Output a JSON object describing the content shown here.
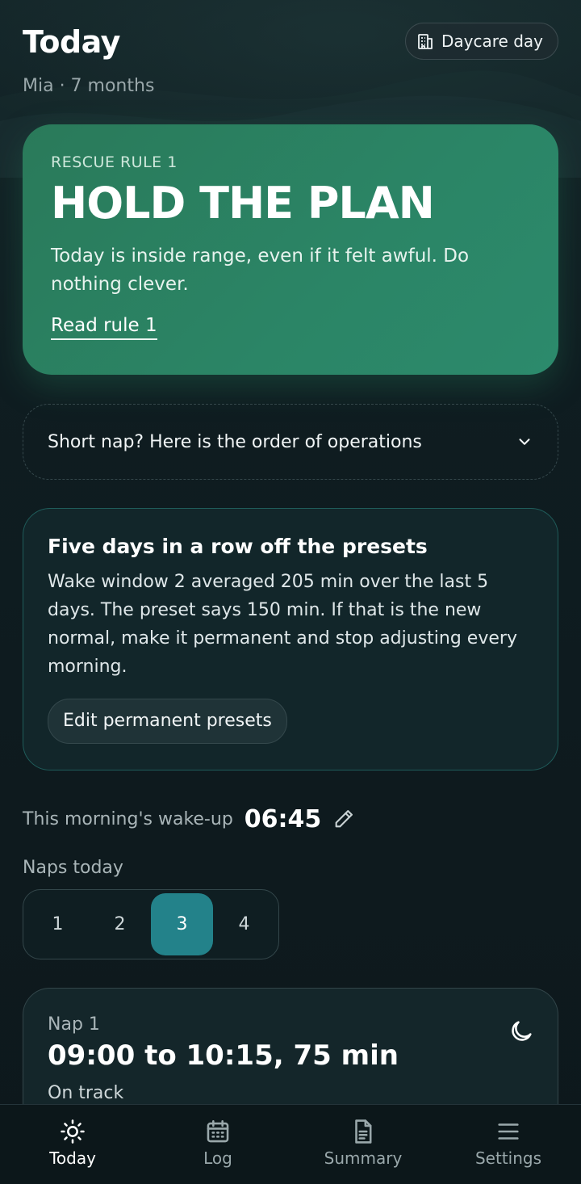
{
  "header": {
    "title": "Today",
    "subtitle": "Mia · 7 months",
    "daycare_button_label": "Daycare day"
  },
  "rescue": {
    "kicker": "RESCUE RULE 1",
    "headline": "HOLD THE PLAN",
    "body": "Today is inside range, even if it felt awful. Do nothing clever.",
    "link_label": "Read rule 1",
    "color": "#2b8566"
  },
  "accordion": {
    "label": "Short nap? Here is the order of operations"
  },
  "insight": {
    "title": "Five days in a row off the presets",
    "body": "Wake window 2 averaged 205 min over the last 5 days. The preset says 150 min. If that is the new normal, make it permanent and stop adjusting every morning.",
    "button_label": "Edit permanent presets"
  },
  "wake": {
    "label": "This morning's wake-up",
    "time": "06:45"
  },
  "naps": {
    "label": "Naps today",
    "options": [
      "1",
      "2",
      "3",
      "4"
    ],
    "selected": "3",
    "accent": "#23828a"
  },
  "nap_card": {
    "kicker": "Nap 1",
    "time_range": "09:00 to 10:15, 75 min",
    "status": "On track"
  },
  "nav": {
    "items": [
      {
        "label": "Today",
        "icon": "sun-icon",
        "active": true
      },
      {
        "label": "Log",
        "icon": "calendar-icon",
        "active": false
      },
      {
        "label": "Summary",
        "icon": "document-icon",
        "active": false
      },
      {
        "label": "Settings",
        "icon": "menu-icon",
        "active": false
      }
    ]
  }
}
